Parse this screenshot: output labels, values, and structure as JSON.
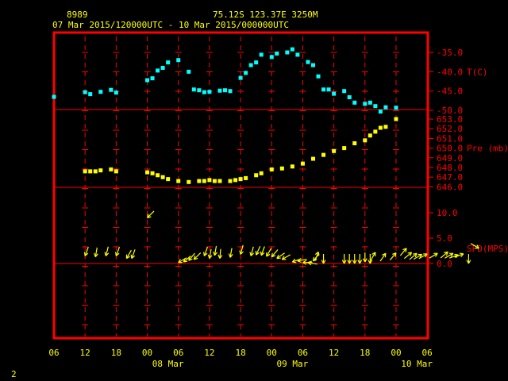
{
  "header": {
    "station_id": "8989",
    "location": "75.12S   123.37E   3250M",
    "period": "07 Mar 2015/120000UTC - 10 Mar 2015/000000UTC"
  },
  "footer": {
    "page_number": "2"
  },
  "colors": {
    "frame": "#ff0000",
    "grid": "#ff0000",
    "temperature": "#00ffff",
    "pressure": "#ffff00",
    "wind": "#ffff00",
    "header_text": "#ffff00",
    "axis_text": "#ffff00",
    "panel_text": "#ff0000",
    "background": "#000000"
  },
  "chart_data": [
    {
      "type": "scatter",
      "panel": "temperature",
      "ylabel": "T(C)",
      "x_unit": "hours since 07 Mar 2015 06 UTC",
      "yticks": [
        "-35.0",
        "-40.0",
        "-45.0",
        "-50.0"
      ],
      "ylim": [
        -50,
        -35
      ],
      "series": [
        {
          "x": [
            0,
            6,
            7,
            9,
            11,
            12,
            18,
            19,
            20,
            21,
            22,
            24,
            26,
            27,
            28,
            29,
            30,
            32,
            33,
            34,
            36,
            37,
            38,
            39,
            40,
            42,
            43,
            45,
            46,
            47,
            49,
            50,
            51,
            52,
            53,
            54,
            56,
            57,
            58,
            60,
            61,
            62,
            63,
            64,
            66
          ],
          "y": [
            -46.5,
            -45.3,
            -45.8,
            -45.2,
            -44.7,
            -45.4,
            -42.2,
            -41.7,
            -39.7,
            -39.0,
            -37.6,
            -37.0,
            -40.0,
            -44.6,
            -44.8,
            -45.3,
            -45.2,
            -44.9,
            -44.8,
            -45.0,
            -41.6,
            -40.3,
            -38.3,
            -37.6,
            -35.6,
            -36.2,
            -35.3,
            -35.0,
            -34.2,
            -35.6,
            -37.5,
            -38.3,
            -41.2,
            -44.6,
            -44.6,
            -45.7,
            -45.0,
            -46.6,
            -48.0,
            -48.3,
            -48.0,
            -48.9,
            -50.3,
            -49.2,
            -49.3
          ]
        }
      ]
    },
    {
      "type": "scatter",
      "panel": "pressure",
      "ylabel": "Pre (mb)",
      "x_unit": "hours since 07 Mar 2015 06 UTC",
      "yticks": [
        "653.0",
        "652.0",
        "651.0",
        "650.0",
        "649.0",
        "648.0",
        "647.0",
        "646.0"
      ],
      "ylim": [
        646,
        653
      ],
      "series": [
        {
          "x": [
            6,
            7,
            8,
            9,
            11,
            12,
            18,
            19,
            20,
            21,
            22,
            24,
            26,
            28,
            29,
            30,
            31,
            32,
            34,
            35,
            36,
            37,
            39,
            40,
            42,
            44,
            46,
            48,
            50,
            52,
            54,
            56,
            58,
            60,
            61,
            62,
            63,
            64,
            66
          ],
          "y": [
            647.6,
            647.6,
            647.6,
            647.7,
            647.8,
            647.6,
            647.5,
            647.4,
            647.2,
            647.0,
            646.8,
            646.6,
            646.5,
            646.6,
            646.6,
            646.7,
            646.6,
            646.6,
            646.6,
            646.7,
            646.8,
            646.9,
            647.2,
            647.4,
            647.8,
            647.9,
            648.1,
            648.4,
            648.9,
            649.3,
            649.7,
            650.0,
            650.5,
            650.8,
            651.3,
            651.7,
            652.1,
            652.2,
            653.0
          ]
        }
      ]
    },
    {
      "type": "scatter",
      "panel": "wind",
      "ylabel": "SPD(MPS)",
      "x_unit": "hours since 07 Mar 2015 06 UTC",
      "yticks": [
        "10.0",
        "5.0",
        "0.0"
      ],
      "ylim": [
        0,
        10
      ],
      "series": [
        {
          "name": "wind barbs",
          "x": [
            6,
            8,
            10,
            12,
            14,
            15,
            24,
            25,
            26,
            27,
            29,
            30,
            31,
            32,
            34,
            36,
            38,
            39,
            40,
            41,
            42,
            43,
            44,
            46,
            47,
            48,
            49,
            50,
            51,
            52,
            56,
            57,
            58,
            59,
            60,
            61,
            62,
            64,
            66,
            68,
            69,
            70,
            71,
            72,
            74,
            76,
            77,
            78,
            79,
            80,
            82
          ],
          "y": [
            1.5,
            1.3,
            1.5,
            1.5,
            1.0,
            1.0,
            0.2,
            0.3,
            0.6,
            0.8,
            1.5,
            1.0,
            1.6,
            1.0,
            1.2,
            1.8,
            1.5,
            1.7,
            1.6,
            1.4,
            1.3,
            1.0,
            0.8,
            0.3,
            0.5,
            0.2,
            0.2,
            0.5,
            2.3,
            0.0,
            0.0,
            0.0,
            0.0,
            0.0,
            0.3,
            0.0,
            2.2,
            2.0,
            2.1,
            3.0,
            2.2,
            2.0,
            1.8,
            1.9,
            2.0,
            2.3,
            2.0,
            1.7,
            1.9,
            0.0,
            3.0
          ],
          "dir_deg": [
            20,
            10,
            15,
            20,
            30,
            20,
            60,
            50,
            40,
            45,
            20,
            10,
            10,
            5,
            10,
            15,
            15,
            25,
            20,
            30,
            40,
            55,
            60,
            70,
            80,
            90,
            100,
            40,
            200,
            0,
            0,
            0,
            0,
            0,
            0,
            0,
            210,
            215,
            220,
            220,
            230,
            230,
            240,
            240,
            240,
            230,
            240,
            250,
            250,
            0,
            300
          ]
        }
      ],
      "annotations": [
        {
          "x": 18,
          "y": 9.0,
          "dir_deg": 45,
          "label": ""
        }
      ]
    }
  ],
  "x_axis": {
    "hour_labels": [
      "06",
      "12",
      "18",
      "00",
      "06",
      "12",
      "18",
      "00",
      "06",
      "12",
      "18",
      "00",
      "06"
    ],
    "day_labels": [
      "08 Mar",
      "09 Mar",
      "10 Mar"
    ]
  }
}
